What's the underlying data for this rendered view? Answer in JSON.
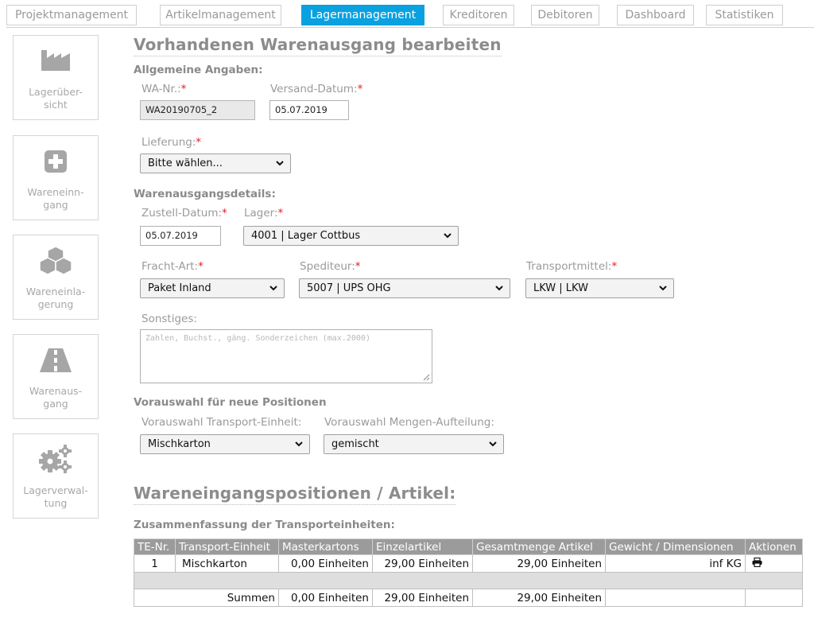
{
  "tabs": [
    {
      "label": "Projektmanagement"
    },
    {
      "label": "Artikelmanagement"
    },
    {
      "label": "Lagermanagement",
      "active": true
    },
    {
      "label": "Kreditoren"
    },
    {
      "label": "Debitoren"
    },
    {
      "label": "Dashboard"
    },
    {
      "label": "Statistiken"
    }
  ],
  "sidebar": {
    "items": [
      {
        "label": "Lagerüber-\nsicht",
        "icon": "factory-icon"
      },
      {
        "label": "Wareneinn-\ngang",
        "icon": "plus-square-icon"
      },
      {
        "label": "Wareneinla-\ngerung",
        "icon": "cubes-icon"
      },
      {
        "label": "Warenaus-\ngang",
        "icon": "road-icon"
      },
      {
        "label": "Lagerverwal-\ntung",
        "icon": "gears-icon"
      }
    ]
  },
  "form": {
    "title": "Vorhandenen Warenausgang bearbeiten",
    "general_heading": "Allgemeine Angaben:",
    "wa_nr": {
      "label": "WA-Nr.:",
      "value": "WA20190705_2"
    },
    "versand_datum": {
      "label": "Versand-Datum:",
      "value": "05.07.2019"
    },
    "lieferung": {
      "label": "Lieferung:",
      "value": "Bitte wählen..."
    },
    "details_heading": "Warenausgangsdetails:",
    "zustell_datum": {
      "label": "Zustell-Datum:",
      "value": "05.07.2019"
    },
    "lager": {
      "label": "Lager:",
      "value": "4001 | Lager Cottbus"
    },
    "fracht_art": {
      "label": "Fracht-Art:",
      "value": "Paket Inland"
    },
    "spediteur": {
      "label": "Spediteur:",
      "value": "5007 | UPS OHG"
    },
    "transportmittel": {
      "label": "Transportmittel:",
      "value": "LKW | LKW"
    },
    "sonstiges": {
      "label": "Sonstiges:",
      "placeholder": "Zahlen, Buchst., gäng. Sonderzeichen (max.2000)"
    },
    "preselect_heading": "Vorauswahl für neue Positionen",
    "transport_einheit": {
      "label": "Vorauswahl Transport-Einheit:",
      "value": "Mischkarton"
    },
    "mengen_aufteilung": {
      "label": "Vorauswahl Mengen-Aufteilung:",
      "value": "gemischt"
    }
  },
  "positions": {
    "title": "Wareneingangspositionen / Artikel:",
    "summary_heading": "Zusammenfassung der Transporteinheiten:",
    "columns": [
      "TE-Nr.",
      "Transport-Einheit",
      "Masterkartons",
      "Einzelartikel",
      "Gesamtmenge Artikel",
      "Gewicht / Dimensionen",
      "Aktionen"
    ],
    "rows": [
      {
        "te_nr": "1",
        "einheit": "Mischkarton",
        "masterkartons": "0,00 Einheiten",
        "einzelartikel": "29,00 Einheiten",
        "gesamtmenge": "29,00 Einheiten",
        "gewicht": "inf KG"
      }
    ],
    "sums": {
      "label": "Summen",
      "masterkartons": "0,00 Einheiten",
      "einzelartikel": "29,00 Einheiten",
      "gesamtmenge": "29,00 Einheiten"
    }
  },
  "colors": {
    "accent": "#0aa1e0",
    "required": "#e02020",
    "table_header": "#9b9b9b"
  }
}
